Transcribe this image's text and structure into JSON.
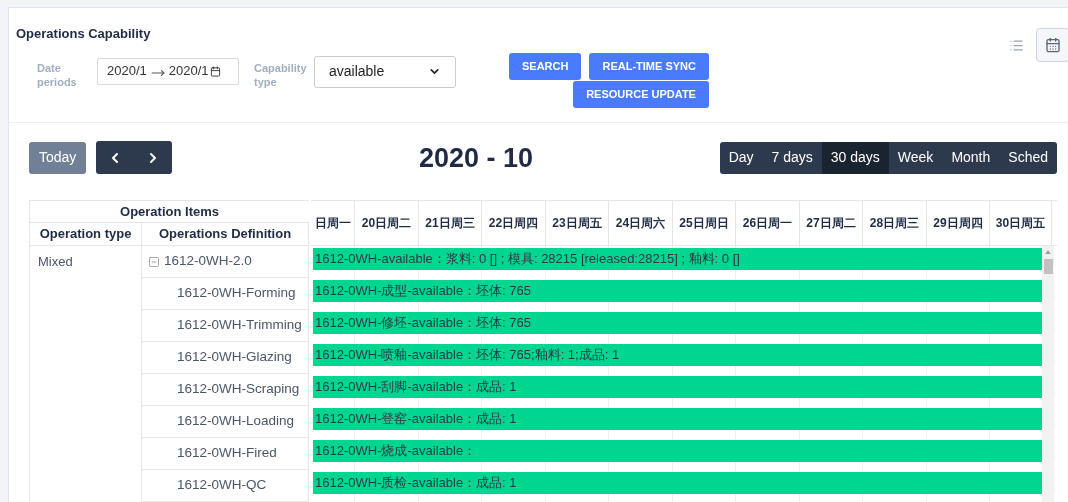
{
  "title": "Operations Capability",
  "view_toggles": [
    {
      "kind": "list",
      "selected": false
    },
    {
      "kind": "calendar",
      "selected": true
    }
  ],
  "filters": {
    "date_label": "Date periods",
    "date_start": "2020/1",
    "date_end": "2020/1",
    "capability_label": "Capability type",
    "capability_value": "available"
  },
  "buttons": [
    "SEARCH",
    "REAL-TIME SYNC",
    "RESOURCE UPDATE"
  ],
  "toolbar": {
    "today": "Today",
    "period": "2020 - 10",
    "views": [
      {
        "label": "Day",
        "selected": false
      },
      {
        "label": "7 days",
        "selected": false
      },
      {
        "label": "30 days",
        "selected": true
      },
      {
        "label": "Week",
        "selected": false
      },
      {
        "label": "Month",
        "selected": false
      },
      {
        "label": "Sched",
        "selected": false
      }
    ]
  },
  "table": {
    "group_header": "Operation Items",
    "columns": [
      "Operation type",
      "Operations Definition"
    ],
    "days": [
      "日周一",
      "20日周二",
      "21日周三",
      "22日周四",
      "23日周五",
      "24日周六",
      "25日周日",
      "26日周一",
      "27日周二",
      "28日周三",
      "29日周四",
      "30日周五"
    ],
    "groups": [
      {
        "type": "Mixed",
        "items": [
          {
            "definition": "1612-0WH-2.0",
            "expanded": true,
            "bar": "1612-0WH-available：浆料: 0 [] ; 模具: 28215 [released:28215] ; 釉料: 0 []",
            "children": [
              {
                "definition": "1612-0WH-Forming",
                "bar": "1612-0WH-成型-available：坯体: 765"
              },
              {
                "definition": "1612-0WH-Trimming",
                "bar": "1612-0WH-修坯-available：坯体: 765"
              },
              {
                "definition": "1612-0WH-Glazing",
                "bar": "1612-0WH-喷釉-available：坯体: 765;釉料: 1;成品: 1"
              },
              {
                "definition": "1612-0WH-Scraping",
                "bar": "1612-0WH-刮脚-available：成品: 1"
              },
              {
                "definition": "1612-0WH-Loading",
                "bar": "1612-0WH-登窑-available：成品: 1"
              },
              {
                "definition": "1612-0WH-Fired",
                "bar": "1612-0WH-烧成-available："
              },
              {
                "definition": "1612-0WH-QC",
                "bar": "1612-0WH-质检-available：成品: 1"
              }
            ]
          }
        ]
      }
    ]
  }
}
